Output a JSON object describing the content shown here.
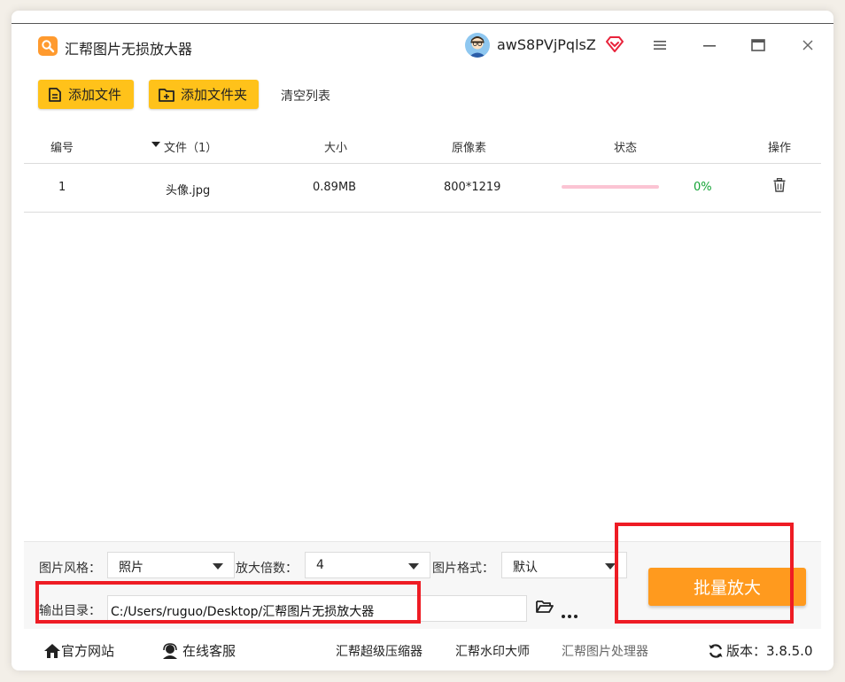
{
  "app": {
    "title": "汇帮图片无损放大器"
  },
  "user": {
    "name": "awS8PVjPqlsZ"
  },
  "toolbar": {
    "add_file_label": "添加文件",
    "add_folder_label": "添加文件夹",
    "clear_list_label": "清空列表"
  },
  "table": {
    "headers": {
      "index": "编号",
      "file": "文件（1）",
      "size": "大小",
      "pixels": "原像素",
      "status": "状态",
      "action": "操作"
    },
    "rows": [
      {
        "index": "1",
        "name": "头像.jpg",
        "size": "0.89MB",
        "pixels": "800*1219",
        "progress": 0,
        "status_text": "0%"
      }
    ]
  },
  "settings": {
    "style_label": "图片风格：",
    "style_value": "照片",
    "scale_label": "放大倍数：",
    "scale_value": "4",
    "format_label": "图片格式：",
    "format_value": "默认",
    "output_label": "输出目录：",
    "output_value": "C:/Users/ruguo/Desktop/汇帮图片无损放大器"
  },
  "actions": {
    "batch_label": "批量放大"
  },
  "footer": {
    "website_label": "官方网站",
    "support_label": "在线客服",
    "link_compressor": "汇帮超级压缩器",
    "link_watermark": "汇帮水印大师",
    "link_processor": "汇帮图片处理器",
    "version_label": "版本：",
    "version_value": "3.8.5.0"
  },
  "colors": {
    "accent_yellow": "#ffc21a",
    "accent_orange": "#ff9a1e",
    "progress_track": "#fbc4d3",
    "success_green": "#13a335",
    "annotation_red": "#ee1c24"
  }
}
